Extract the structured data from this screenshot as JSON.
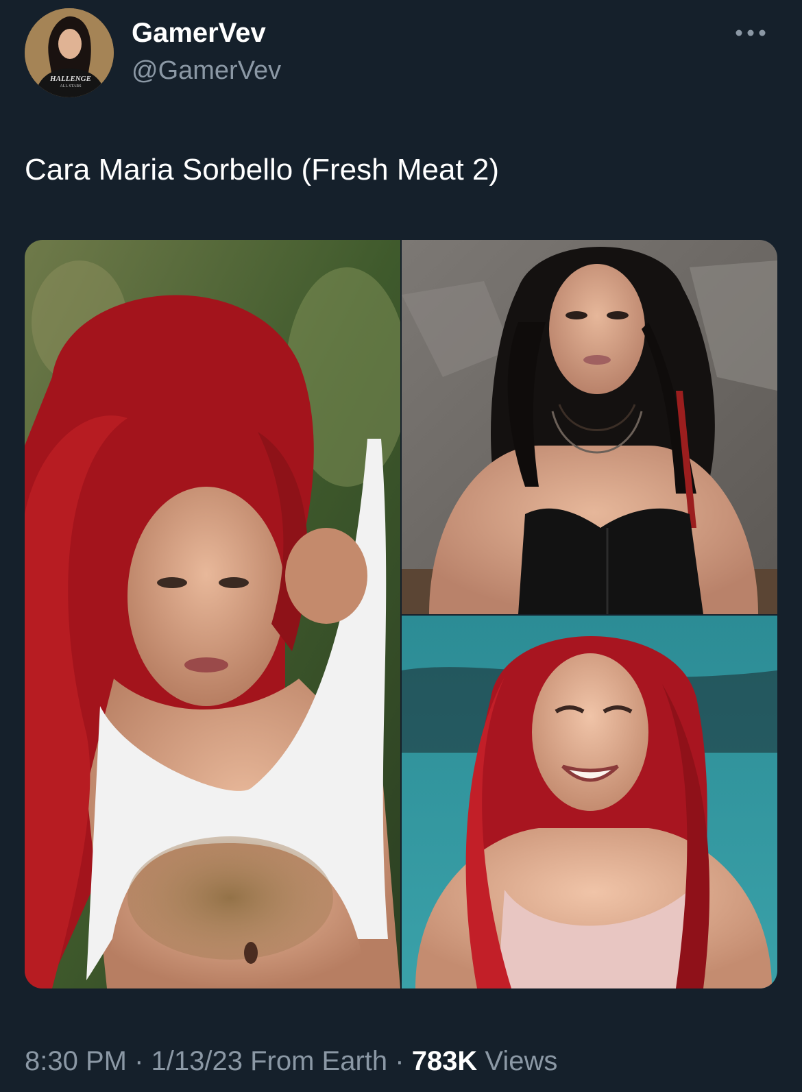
{
  "author": {
    "display_name": "GamerVev",
    "handle": "@GamerVev",
    "avatar_text": "CHALLENGE ALL STARS"
  },
  "tweet": {
    "text": "Cara Maria Sorbello (Fresh Meat 2)"
  },
  "media": {
    "photos": [
      {
        "name": "photo-1"
      },
      {
        "name": "photo-2"
      },
      {
        "name": "photo-3"
      }
    ]
  },
  "meta": {
    "time": "8:30 PM",
    "sep1": " · ",
    "date": "1/13/23",
    "source": " From Earth",
    "sep2": " · ",
    "views_count": "783K",
    "views_label": " Views"
  },
  "icons": {
    "more": "more-dots-icon"
  },
  "colors": {
    "background": "#15202b",
    "primary_text": "#ffffff",
    "secondary_text": "#8b98a5"
  }
}
